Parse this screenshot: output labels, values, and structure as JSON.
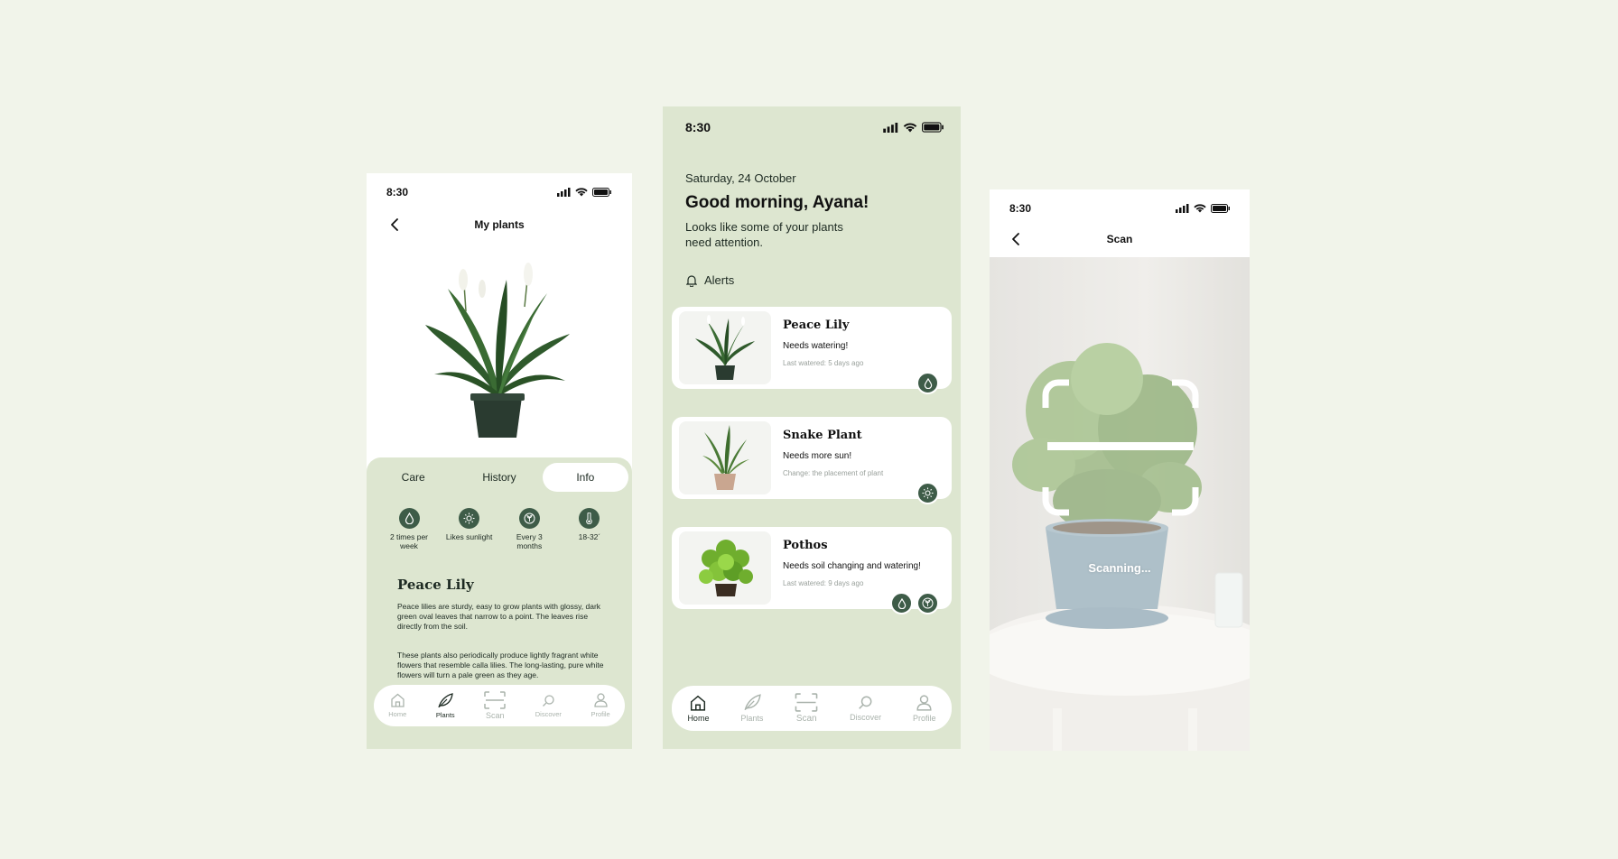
{
  "colors": {
    "background": "#f1f4ea",
    "panel": "#dde6d0",
    "accent": "#3e5c48"
  },
  "nav": {
    "home": "Home",
    "plants": "Plants",
    "scan": "Scan",
    "discover": "Discover",
    "profile": "Profile"
  },
  "plants_screen": {
    "time": "8:30",
    "title": "My plants",
    "tabs": {
      "care": "Care",
      "history": "History",
      "info": "Info",
      "active": "Info"
    },
    "care": {
      "water": "2 times per week",
      "light": "Likes sunlight",
      "soil": "Every 3 months",
      "temp": "18-32´"
    },
    "plant_name": "Peace Lily",
    "desc1": "Peace lilies are sturdy, easy to grow plants with glossy, dark green oval leaves that narrow to a point. The leaves rise directly from the soil.",
    "desc2": "These plants also periodically produce lightly fragrant white flowers that resemble calla lilies. The long-lasting, pure white flowers will turn a pale green as they age."
  },
  "home_screen": {
    "time": "8:30",
    "date": "Saturday, 24 October",
    "greeting": "Good morning, Ayana!",
    "subtitle": "Looks like some of your plants need attention.",
    "alerts_label": "Alerts",
    "cards": [
      {
        "name": "Peace Lily",
        "message": "Needs watering!",
        "note": "Last watered: 5 days ago",
        "badges": [
          "water-drop-icon"
        ]
      },
      {
        "name": "Snake Plant",
        "message": "Needs more sun!",
        "note": "Change: the placement of plant",
        "badges": [
          "sun-icon"
        ]
      },
      {
        "name": "Pothos",
        "message": "Needs soil changing and watering!",
        "note": "Last watered: 9 days ago",
        "badges": [
          "water-drop-icon",
          "soil-icon"
        ]
      }
    ]
  },
  "scan_screen": {
    "time": "8:30",
    "title": "Scan",
    "status": "Scanning..."
  }
}
